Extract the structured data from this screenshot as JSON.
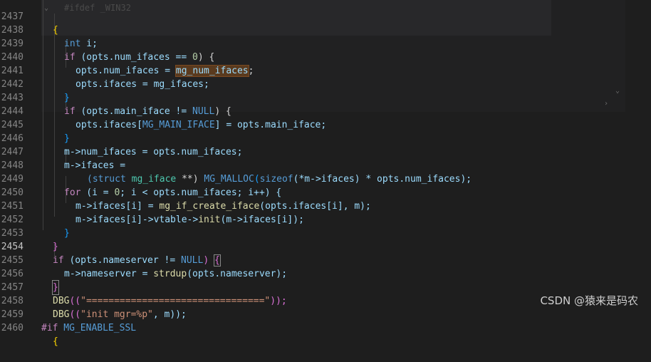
{
  "editor": {
    "ghost_text": "#ifdef _WIN32",
    "active_line": "2454",
    "lines": [
      {
        "n": "2437"
      },
      {
        "n": "2438"
      },
      {
        "n": "2439"
      },
      {
        "n": "2440"
      },
      {
        "n": "2441"
      },
      {
        "n": "2442"
      },
      {
        "n": "2443"
      },
      {
        "n": "2444"
      },
      {
        "n": "2445"
      },
      {
        "n": "2446"
      },
      {
        "n": "2447"
      },
      {
        "n": "2448"
      },
      {
        "n": "2449"
      },
      {
        "n": "2450"
      },
      {
        "n": "2451"
      },
      {
        "n": "2452"
      },
      {
        "n": "2453"
      },
      {
        "n": "2454"
      },
      {
        "n": "2455"
      },
      {
        "n": "2456"
      },
      {
        "n": "2457"
      },
      {
        "n": "2458"
      },
      {
        "n": "2459"
      },
      {
        "n": "2460"
      }
    ],
    "tokens": {
      "l2437": "{",
      "l2438_kw": "int",
      "l2438_rest": " i;",
      "l2439_if": "if",
      "l2439_a": " (opts.num_ifaces == ",
      "l2439_num": "0",
      "l2439_b": ") {",
      "l2440_a": "opts.num_ifaces = ",
      "l2440_hl": "mg_num_ifaces",
      "l2440_b": ";",
      "l2441": "opts.ifaces = mg_ifaces;",
      "l2442": "}",
      "l2443_if": "if",
      "l2443_a": " (opts.main_iface != ",
      "l2443_null": "NULL",
      "l2443_b": ") {",
      "l2444_a": "opts.ifaces[",
      "l2444_macro": "MG_MAIN_IFACE",
      "l2444_b": "] = opts.main_iface;",
      "l2445": "}",
      "l2446": "m->num_ifaces = opts.num_ifaces;",
      "l2447": "m->ifaces =",
      "l2448_a": "(struct ",
      "l2448_type": "mg_iface",
      "l2448_b": " **) ",
      "l2448_fn": "MG_MALLOC",
      "l2448_c": "(",
      "l2448_kw": "sizeof",
      "l2448_d": "(*m->ifaces) * opts.num_ifaces);",
      "l2449_for": "for",
      "l2449_a": " (i = ",
      "l2449_num": "0",
      "l2449_b": "; i < opts.num_ifaces; i++) {",
      "l2450_a": "m->ifaces[i] = ",
      "l2450_fn": "mg_if_create_iface",
      "l2450_b": "(opts.ifaces[i], m);",
      "l2451_a": "m->ifaces[i]->vtable->",
      "l2451_fn": "init",
      "l2451_b": "(m->ifaces[i]);",
      "l2452": "}",
      "l2453": "}",
      "l2454_if": "if",
      "l2454_a": " (opts.nameserver != ",
      "l2454_null": "NULL",
      "l2454_b": ") ",
      "l2454_c": "{",
      "l2455_a": "m->nameserver = ",
      "l2455_fn": "strdup",
      "l2455_b": "(opts.nameserver);",
      "l2456": "}",
      "l2457_fn": "DBG",
      "l2457_a": "((",
      "l2457_str": "\"================================\"",
      "l2457_b": "));",
      "l2458_fn": "DBG",
      "l2458_a": "((",
      "l2458_str": "\"init mgr=%p\"",
      "l2458_b": ", m));",
      "l2459_pp": "#if",
      "l2459_macro": " MG_ENABLE_SSL",
      "l2460": "{"
    }
  },
  "watermark": "CSDN @猿来是码农",
  "colors": {
    "background": "#1e1e1e",
    "keyword": "#569cd6",
    "control": "#c586c0",
    "function": "#dcdcaa",
    "string": "#ce9178",
    "number": "#b5cea8",
    "type": "#4ec9b0"
  }
}
